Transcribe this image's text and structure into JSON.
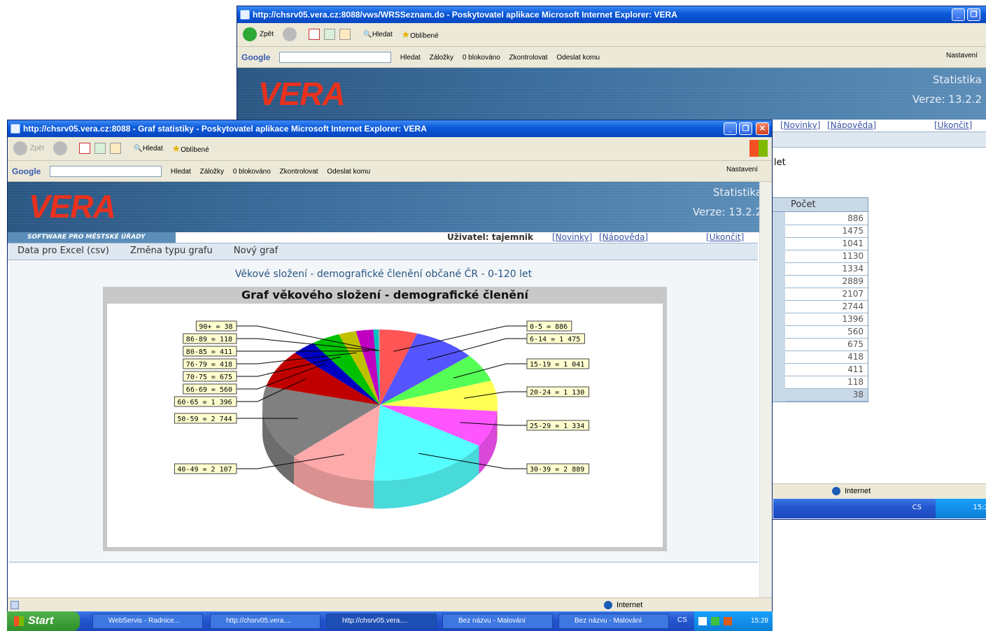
{
  "back_window": {
    "title": "http://chsrv05.vera.cz:8088/vws/WRSSeznam.do - Poskytovatel aplikace Microsoft Internet Explorer: VERA",
    "toolbar": {
      "back": "Zpět",
      "search": "Hledat",
      "favorites": "Oblíbené"
    },
    "google_bar": {
      "logo": "Google",
      "search": "Hledat",
      "bookmarks": "Záložky",
      "blocked": "0 blokováno",
      "check": "Zkontrolovat",
      "send": "Odeslat komu",
      "settings": "Nastavení"
    },
    "banner": {
      "logo": "VERA",
      "stat": "Statistika",
      "version": "Verze: 13.2.2"
    },
    "links": {
      "news": "[Novinky]",
      "help": "[Nápověda]",
      "quit": "[Ukončit]"
    },
    "partial_label": "let",
    "count_header": "Počet",
    "counts": [
      "886",
      "1475",
      "1041",
      "1130",
      "1334",
      "2889",
      "2107",
      "2744",
      "1396",
      "560",
      "675",
      "418",
      "411",
      "118",
      "38"
    ],
    "status": "Internet",
    "tray": {
      "lang": "CS",
      "time": "15:2"
    }
  },
  "front_window": {
    "title": "http://chsrv05.vera.cz:8088 - Graf statistiky - Poskytovatel aplikace Microsoft Internet Explorer: VERA",
    "toolbar": {
      "back": "Zpět",
      "search": "Hledat",
      "favorites": "Oblíbené"
    },
    "google_bar": {
      "logo": "Google",
      "search": "Hledat",
      "bookmarks": "Záložky",
      "blocked": "0 blokováno",
      "check": "Zkontrolovat",
      "send": "Odeslat komu",
      "settings": "Nastavení"
    },
    "banner": {
      "logo": "VERA",
      "tagline": "SOFTWARE PRO MĚSTSKÉ ÚŘADY",
      "stat": "Statistika",
      "version": "Verze: 13.2.2"
    },
    "user": "Uživatel: tajemnik",
    "links": {
      "news": "[Novinky]",
      "help": "[Nápověda]",
      "quit": "[Ukončit]"
    },
    "menu": {
      "excel": "Data pro Excel (csv)",
      "change": "Změna typu grafu",
      "new": "Nový graf"
    },
    "heading": "Věkové složení - demografické členění občané ČR - 0-120 let",
    "status": "Internet"
  },
  "chart_data": {
    "type": "pie",
    "title": "Graf věkového složení - demografické členění",
    "categories": [
      "0-5",
      "6-14",
      "15-19",
      "20-24",
      "25-29",
      "30-39",
      "40-49",
      "50-59",
      "60-65",
      "66-69",
      "70-75",
      "76-79",
      "80-85",
      "86-89",
      "90+"
    ],
    "values": [
      886,
      1475,
      1041,
      1130,
      1334,
      2889,
      2107,
      2744,
      1396,
      560,
      675,
      418,
      411,
      118,
      38
    ],
    "labels": [
      "0-5 = 886",
      "6-14 = 1 475",
      "15-19 = 1 041",
      "20-24 = 1 130",
      "25-29 = 1 334",
      "30-39 = 2 889",
      "40-49 = 2 107",
      "50-59 = 2 744",
      "60-65 = 1 396",
      "66-69 = 560",
      "70-75 = 675",
      "76-79 = 418",
      "80-85 = 411",
      "86-89 = 118",
      "90+ = 38"
    ],
    "colors": [
      "#ff5555",
      "#5555ff",
      "#55ff55",
      "#ffff55",
      "#ff55ff",
      "#55ffff",
      "#ffaaaa",
      "#808080",
      "#c00000",
      "#0000c0",
      "#00c000",
      "#c0c000",
      "#c000c0",
      "#00c0c0",
      "#a0a0a0"
    ]
  },
  "taskbar": {
    "start": "Start",
    "tasks": [
      "WebServis - Radnice...",
      "http://chsrv05.vera....",
      "http://chsrv05.vera....",
      "Bez názvu - Malování",
      "Bez názvu - Malování"
    ],
    "lang": "CS",
    "time": "15:28"
  }
}
